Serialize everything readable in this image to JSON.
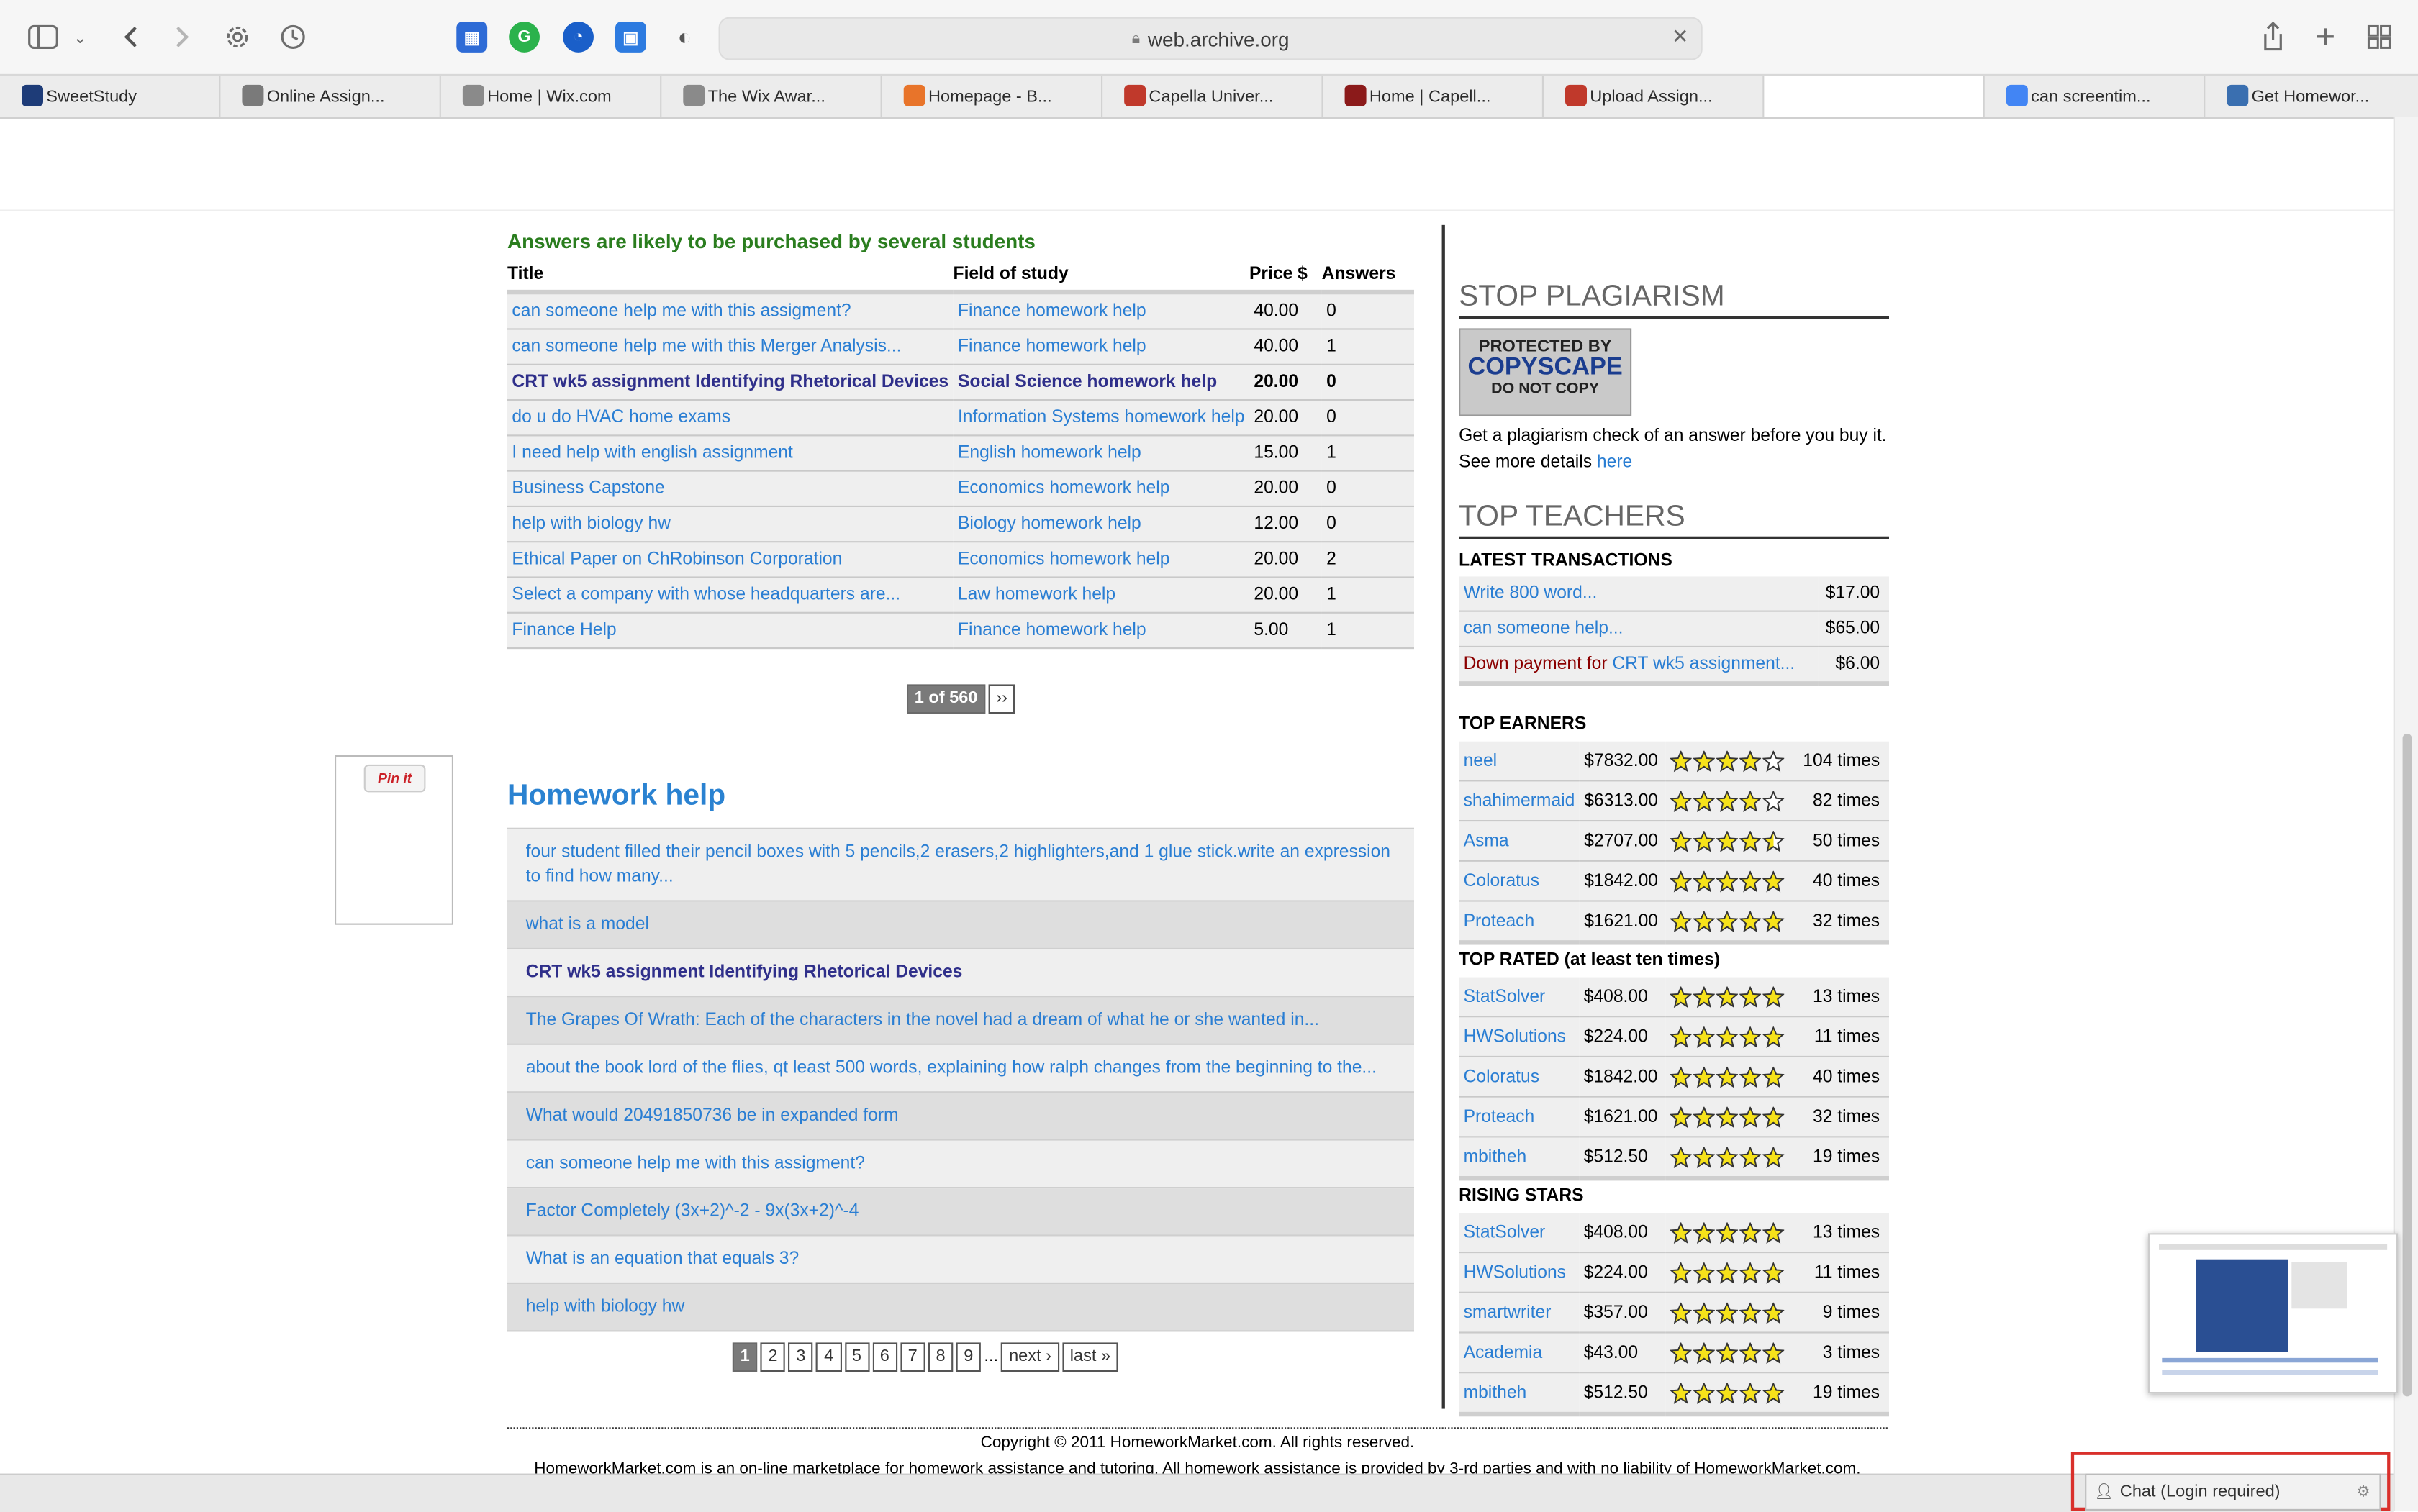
{
  "browser": {
    "url": "web.archive.org",
    "tabs": [
      {
        "label": "SweetStudy",
        "color": "#1e3c78"
      },
      {
        "label": "Online Assign...",
        "color": "#7a7a7a"
      },
      {
        "label": "Home | Wix.com",
        "color": "#8a8a8a"
      },
      {
        "label": "The Wix Awar...",
        "color": "#8a8a8a"
      },
      {
        "label": "Homepage - B...",
        "color": "#e8742a"
      },
      {
        "label": "Capella Univer...",
        "color": "#c0392b"
      },
      {
        "label": "Home | Capell...",
        "color": "#8b1a1a"
      },
      {
        "label": "Upload Assign...",
        "color": "#c0392b"
      },
      {
        "label": "",
        "color": "#ffffff"
      },
      {
        "label": "can screentim...",
        "color": "#4285f4"
      },
      {
        "label": "Get Homewor...",
        "color": "#3a6fb0"
      }
    ]
  },
  "questions": {
    "heading": "Answers are likely to be purchased by several students",
    "headers": {
      "title": "Title",
      "field": "Field of study",
      "price": "Price $",
      "answers": "Answers"
    },
    "rows": [
      {
        "title": "can someone help me with this assigment?",
        "field": "Finance homework help",
        "price": "40.00",
        "answers": "0",
        "bold": false
      },
      {
        "title": "can someone help me with this Merger Analysis...",
        "field": "Finance homework help",
        "price": "40.00",
        "answers": "1",
        "bold": false
      },
      {
        "title": "CRT wk5 assignment Identifying Rhetorical Devices",
        "field": "Social Science homework help",
        "price": "20.00",
        "answers": "0",
        "bold": true
      },
      {
        "title": "do u do HVAC home exams",
        "field": "Information Systems homework help",
        "price": "20.00",
        "answers": "0",
        "bold": false
      },
      {
        "title": "I need help with english assignment",
        "field": "English homework help",
        "price": "15.00",
        "answers": "1",
        "bold": false
      },
      {
        "title": "Business Capstone",
        "field": "Economics homework help",
        "price": "20.00",
        "answers": "0",
        "bold": false
      },
      {
        "title": "help with biology hw",
        "field": "Biology homework help",
        "price": "12.00",
        "answers": "0",
        "bold": false
      },
      {
        "title": "Ethical Paper on ChRobinson Corporation",
        "field": "Economics homework help",
        "price": "20.00",
        "answers": "2",
        "bold": false
      },
      {
        "title": "Select a company with whose headquarters are...",
        "field": "Law homework help",
        "price": "20.00",
        "answers": "1",
        "bold": false
      },
      {
        "title": "Finance Help",
        "field": "Finance homework help",
        "price": "5.00",
        "answers": "1",
        "bold": false
      }
    ],
    "pager": {
      "current": "1 of 560",
      "next": "››"
    }
  },
  "pinit": "Pin it",
  "homework": {
    "heading": "Homework help",
    "items": [
      {
        "text": "four student filled their pencil boxes with 5 pencils,2 erasers,2 highlighters,and 1 glue stick.write an expression to find how many...",
        "bold": false
      },
      {
        "text": "what is a model",
        "bold": false
      },
      {
        "text": "CRT wk5 assignment Identifying Rhetorical Devices",
        "bold": true
      },
      {
        "text": "The Grapes Of Wrath: Each of the characters in the novel had a dream of what he or she wanted in...",
        "bold": false
      },
      {
        "text": "about the book lord of the flies, qt least 500 words, explaining how ralph changes from the beginning to the...",
        "bold": false
      },
      {
        "text": "What would 20491850736 be in expanded form",
        "bold": false
      },
      {
        "text": "can someone help me with this assigment?",
        "bold": false
      },
      {
        "text": "Factor Completely (3x+2)^-2 - 9x(3x+2)^-4",
        "bold": false
      },
      {
        "text": "What is an equation that equals 3?",
        "bold": false
      },
      {
        "text": "help with biology hw",
        "bold": false
      }
    ],
    "pages": [
      "1",
      "2",
      "3",
      "4",
      "5",
      "6",
      "7",
      "8",
      "9"
    ],
    "ellipsis": "...",
    "next": "next ›",
    "last": "last »"
  },
  "sidebar": {
    "plagiarism": {
      "heading": "STOP PLAGIARISM",
      "badge": [
        "PROTECTED BY",
        "COPYSCAPE",
        "DO NOT COPY"
      ],
      "text1": "Get a plagiarism check of an answer before you buy it.",
      "text2": "See more details ",
      "link": "here"
    },
    "teachers_heading": "TOP TEACHERS",
    "latest": {
      "heading": "LATEST TRANSACTIONS",
      "rows": [
        {
          "prefix": "",
          "title": "Write 800 word...",
          "amount": "$17.00"
        },
        {
          "prefix": "",
          "title": "can someone help...",
          "amount": "$65.00"
        },
        {
          "prefix": "Down payment for ",
          "title": "CRT wk5 assignment...",
          "amount": "$6.00"
        }
      ]
    },
    "earners": {
      "heading": "TOP EARNERS",
      "rows": [
        {
          "name": "neel",
          "amount": "$7832.00",
          "rating": 4,
          "times": "104 times"
        },
        {
          "name": "shahimermaid",
          "amount": "$6313.00",
          "rating": 4,
          "times": "82 times"
        },
        {
          "name": "Asma",
          "amount": "$2707.00",
          "rating": 4.5,
          "times": "50 times"
        },
        {
          "name": "Coloratus",
          "amount": "$1842.00",
          "rating": 5,
          "times": "40 times"
        },
        {
          "name": "Proteach",
          "amount": "$1621.00",
          "rating": 5,
          "times": "32 times"
        }
      ]
    },
    "rated": {
      "heading": "TOP RATED (at least ten times)",
      "rows": [
        {
          "name": "StatSolver",
          "amount": "$408.00",
          "rating": 5,
          "times": "13 times"
        },
        {
          "name": "HWSolutions",
          "amount": "$224.00",
          "rating": 5,
          "times": "11 times"
        },
        {
          "name": "Coloratus",
          "amount": "$1842.00",
          "rating": 5,
          "times": "40 times"
        },
        {
          "name": "Proteach",
          "amount": "$1621.00",
          "rating": 5,
          "times": "32 times"
        },
        {
          "name": "mbitheh",
          "amount": "$512.50",
          "rating": 5,
          "times": "19 times"
        }
      ]
    },
    "rising": {
      "heading": "RISING STARS",
      "rows": [
        {
          "name": "StatSolver",
          "amount": "$408.00",
          "rating": 5,
          "times": "13 times"
        },
        {
          "name": "HWSolutions",
          "amount": "$224.00",
          "rating": 5,
          "times": "11 times"
        },
        {
          "name": "smartwriter",
          "amount": "$357.00",
          "rating": 5,
          "times": "9 times"
        },
        {
          "name": "Academia",
          "amount": "$43.00",
          "rating": 5,
          "times": "3 times"
        },
        {
          "name": "mbitheh",
          "amount": "$512.50",
          "rating": 5,
          "times": "19 times"
        }
      ]
    }
  },
  "footer": {
    "copyright": "Copyright © 2011 HomeworkMarket.com. All rights reserved.",
    "disclaimer": "HomeworkMarket.com is an on-line marketplace for homework assistance and tutoring. All homework assistance is provided by 3-rd parties and with no liability of HomeworkMarket.com."
  },
  "chat": {
    "label": "Chat (Login required)"
  }
}
